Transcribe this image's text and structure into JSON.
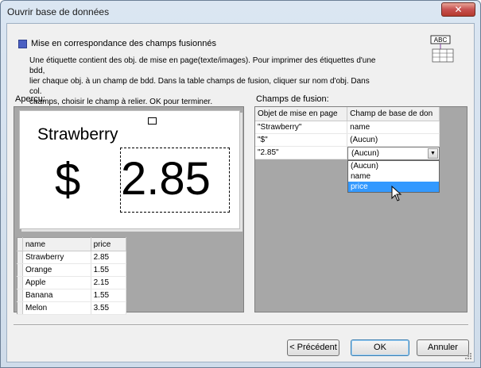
{
  "window": {
    "title": "Ouvrir base de données",
    "close_label": "✕"
  },
  "section": {
    "title": "Mise en correspondance des champs fusionnés",
    "description_lines": [
      "Une étiquette contient des obj. de mise en page(texte/images). Pour imprimer des étiquettes d'une bdd,",
      "lier chaque obj. à un champ de bdd. Dans la table champs de fusion, cliquer sur nom d'obj. Dans col.",
      "champs, choisir le champ à relier. OK pour terminer."
    ],
    "icon_text": "ABC"
  },
  "preview": {
    "label": "Aperçu:",
    "name_text": "Strawberry",
    "dollar_text": "$",
    "price_text": "2.85"
  },
  "database": {
    "headers": [
      "name",
      "price"
    ],
    "rows": [
      [
        "Strawberry",
        "2.85"
      ],
      [
        "Orange",
        "1.55"
      ],
      [
        "Apple",
        "2.15"
      ],
      [
        "Banana",
        "1.55"
      ],
      [
        "Melon",
        "3.55"
      ]
    ]
  },
  "fields": {
    "label": "Champs de fusion:",
    "headers": [
      "Objet de mise en page",
      "Champ de base de don"
    ],
    "rows": [
      [
        "\"Strawberry\"",
        "name"
      ],
      [
        "\"$\"",
        "(Aucun)"
      ],
      [
        "\"2.85\"",
        "(Aucun)"
      ]
    ],
    "combo_value": "(Aucun)",
    "dropdown_options": [
      "(Aucun)",
      "name",
      "price"
    ],
    "dropdown_selected": "price"
  },
  "buttons": {
    "previous": "< Précédent",
    "ok": "OK",
    "cancel": "Annuler"
  }
}
